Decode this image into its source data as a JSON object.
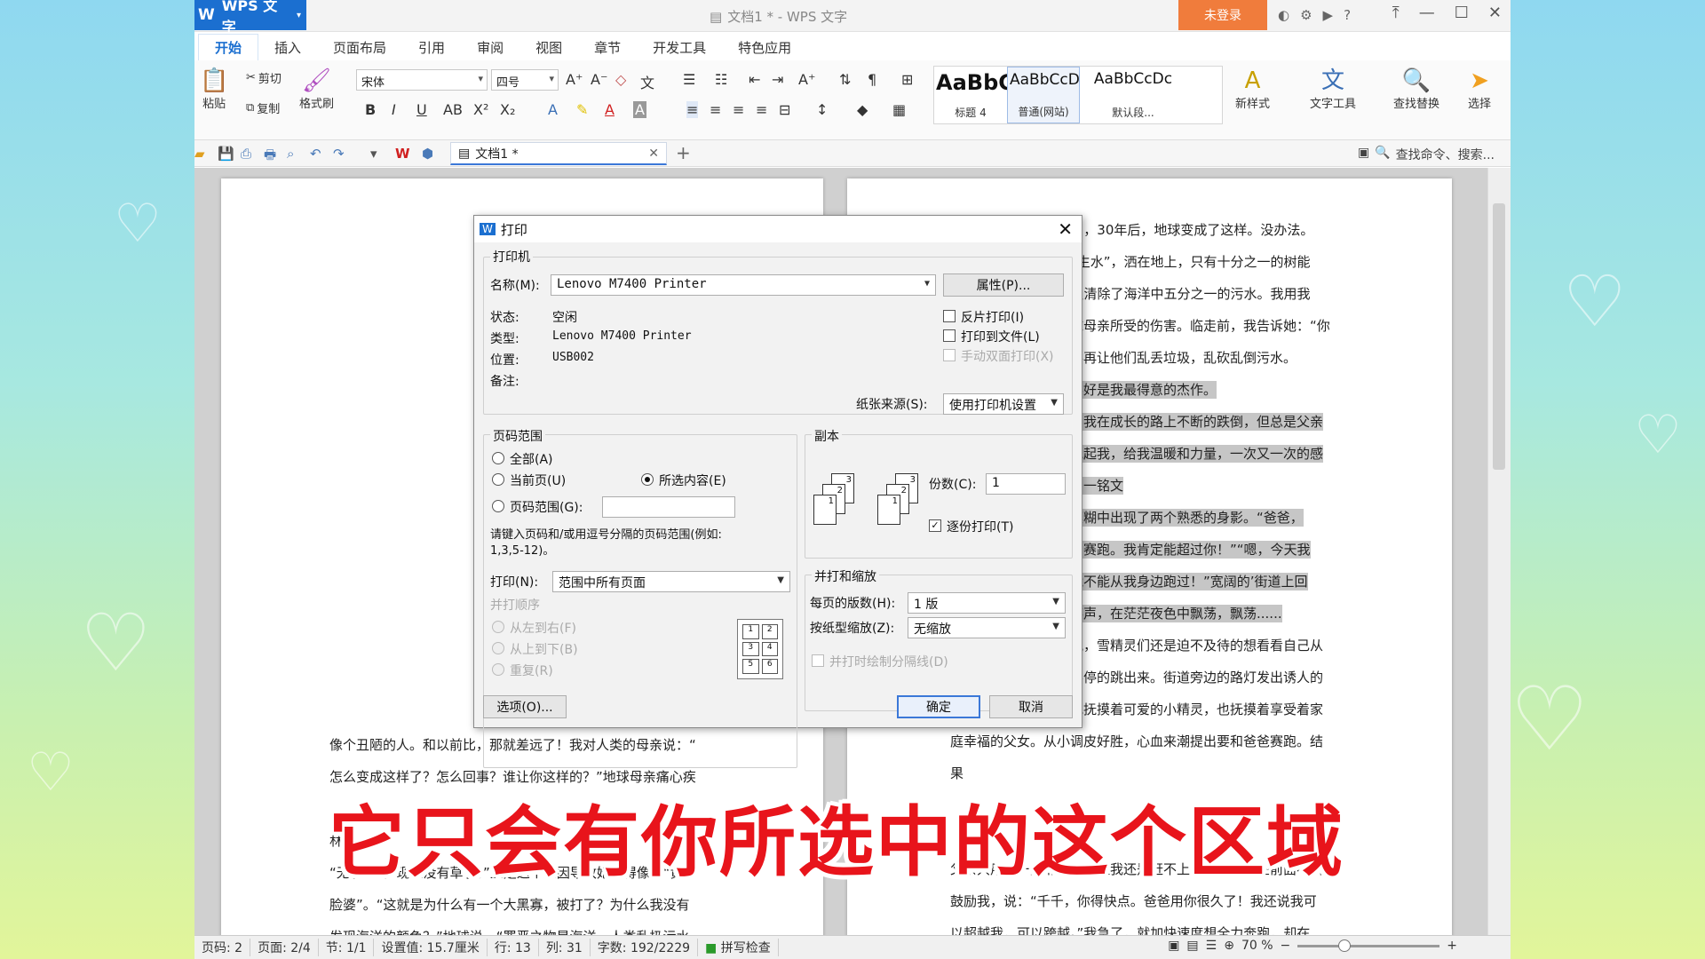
{
  "app": {
    "name": "WPS 文字",
    "window_title": "文档1 * - WPS 文字",
    "login": "未登录"
  },
  "tabs": [
    "开始",
    "插入",
    "页面布局",
    "引用",
    "审阅",
    "视图",
    "章节",
    "开发工具",
    "特色应用"
  ],
  "ribbon": {
    "paste": "粘贴",
    "cut": "剪切",
    "copy": "复制",
    "format_painter": "格式刷",
    "font": "宋体",
    "size": "四号",
    "styles": [
      {
        "preview": "AaBbC",
        "name": "标题 4"
      },
      {
        "preview": "AaBbCcD",
        "name": "普通(网站)"
      },
      {
        "preview": "AaBbCcDc",
        "name": "默认段..."
      }
    ],
    "new_style": "新样式",
    "text_tools": "文字工具",
    "find_replace": "查找替换",
    "select": "选择"
  },
  "doc_tab": "文档1 *",
  "search": "查找命令、搜索...",
  "page1_lines": [
    "像个丑陋的人。和以前比，那就差远了！我对人类的母亲说：“",
    "怎么变成这样了？怎么回事？谁让你这样的？”地球母亲痛心疾",
    "林",
    "“无手”的，现在没有草了。”正是这个原因导致她变得像个“黄",
    "脸婆”。“这就是为什么有一个大黑寡，被打了？为什么我没有",
    "发现海洋的颜色？”地球说。“罪恶之物是海洋，人类乱扔污水"
  ],
  "page2_lines": [
    "导致海洋变黑。”没想到，30年后，地球变成了这样。没办法。",
    "我拿着自己专属的“速生水”，洒在地上，只有十分之一的树能",
    "生长。我用“清洁剂”只清除了海洋中五分之一的污水。我用我",
    "的本能尽可能挽回地球母亲所受的伤害。临走前，我告诉她：“你",
    "要多和人类交流，不要再让他们乱丢垃圾，乱砍乱倒污水。",
    "　　把地球的皮肤保养好是我最得意的杰作。",
    "曾经感动过我的爱情，我在成长的路上不断的跌倒，但总是父亲",
    "温暖有力的手轻轻的抱起我，给我温暖和力量，一次又一次的感",
    "动那颗含苞待放的心。一铭文",
    "　　记忆转向开始，模糊中出现了两个熟悉的身影。“爸爸，",
    "你会放下我吗？让我们赛跑。我肯定能超过你！”“嗯，今天我",
    "要看看我的宝贝女儿能不能从我身边跑过！”宽阔的’街道上回",
    "荡着一对父女幸福的笑声，在茫茫夜色中飘荡，飘荡......",
    "　　虽然此时天色已晚，雪精灵们还是迫不及待的想看看自己从",
    "未见过的小说世界，不停的跳出来。街道旁边的路灯发出诱人的",
    "黄光，静静的。轻轻地抚摸着可爱的小精灵，也抚摸着享受着家",
    "庭幸福的父女。从小调皮好胜，心血来潮提出要和爸爸赛跑。结",
    "果",
    "父亲只用了一点点力气，但我还是赶不上宝宝。爸爸在前面不断",
    "鼓励我，说：“千千，你得快点。爸爸用你很久了！我还说我可",
    "以超越我，可以跨越。”我急了，就加快速度想全力奔跑，却在"
  ],
  "dialog": {
    "title": "打印",
    "printer_group": "打印机",
    "name_label": "名称(M):",
    "printer_name": "Lenovo M7400 Printer",
    "properties": "属性(P)...",
    "status_label": "状态:",
    "status": "空闲",
    "type_label": "类型:",
    "type": "Lenovo M7400 Printer",
    "location_label": "位置:",
    "location": "USB002",
    "comment_label": "备注:",
    "reverse": "反片打印(I)",
    "to_file": "打印到文件(L)",
    "duplex": "手动双面打印(X)",
    "paper_source_label": "纸张来源(S):",
    "paper_source": "使用打印机设置",
    "range_group": "页码范围",
    "all": "全部(A)",
    "current": "当前页(U)",
    "selection": "所选内容(E)",
    "pages": "页码范围(G):",
    "range_hint": "请键入页码和/或用逗号分隔的页码范围(例如:",
    "range_example": "1,3,5-12)。",
    "print_label": "打印(N):",
    "print_value": "范围中所有页面",
    "order_group": "并打顺序",
    "ltr": "从左到右(F)",
    "ttb": "从上到下(B)",
    "repeat": "重复(R)",
    "copies_group": "副本",
    "copies_label": "份数(C):",
    "copies": "1",
    "collate": "逐份打印(T)",
    "zoom_group": "并打和缩放",
    "per_page_label": "每页的版数(H):",
    "per_page": "1 版",
    "scale_label": "按纸型缩放(Z):",
    "scale": "无缩放",
    "draw_sep": "并打时绘制分隔线(D)",
    "options": "选项(O)...",
    "ok": "确定",
    "cancel": "取消",
    "grid_nums": [
      "1",
      "2",
      "3",
      "4",
      "5",
      "6"
    ]
  },
  "status": {
    "page_code": "页码: 2",
    "page": "页面: 2/4",
    "section": "节: 1/1",
    "setting": "设置值: 15.7厘米",
    "row": "行: 13",
    "col": "列: 31",
    "words": "字数: 192/2229",
    "spell": "拼写检查",
    "zoom": "70 %"
  },
  "caption": "它只会有你所选中的这个区域",
  "colors": {
    "accent": "#1b6fd0",
    "login": "#f07c3c",
    "caption": "#e8141b",
    "selection": "#c6c6c6"
  }
}
